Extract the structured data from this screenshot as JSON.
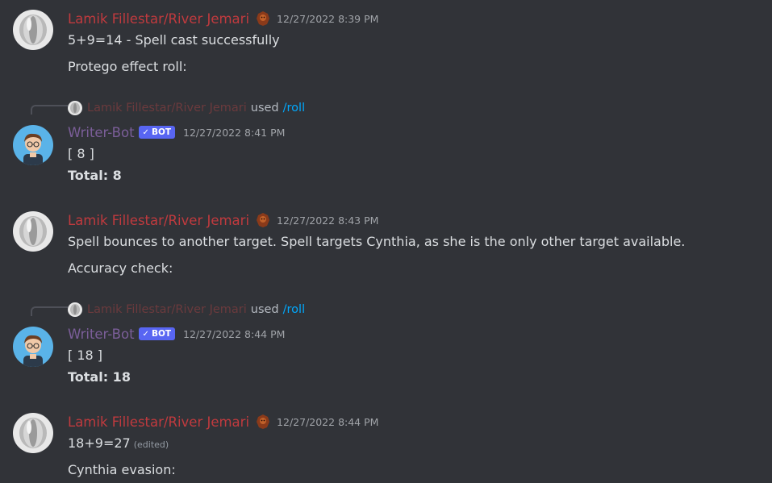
{
  "colors": {
    "background": "#313338",
    "lamik_name": "#c03a3e",
    "bot_name": "#7b5e99",
    "bot_badge": "#5865f2",
    "command": "#00a8fc"
  },
  "messages": [
    {
      "author": "Lamik Fillestar/River Jemari",
      "icon": "house-crest-icon",
      "timestamp": "12/27/2022 8:39 PM",
      "lines": [
        "5+9=14 - Spell cast successfully",
        "Protego effect roll:"
      ]
    },
    {
      "reply": {
        "author": "Lamik Fillestar/River Jemari",
        "used": "used",
        "command": "/roll"
      },
      "author": "Writer-Bot",
      "badge": "BOT",
      "timestamp": "12/27/2022 8:41 PM",
      "roll": "[ 8 ]",
      "total": "Total: 8"
    },
    {
      "author": "Lamik Fillestar/River Jemari",
      "icon": "house-crest-icon",
      "timestamp": "12/27/2022 8:43 PM",
      "lines": [
        "Spell bounces to another target. Spell targets Cynthia, as she is the only other target available.",
        "Accuracy check:"
      ]
    },
    {
      "reply": {
        "author": "Lamik Fillestar/River Jemari",
        "used": "used",
        "command": "/roll"
      },
      "author": "Writer-Bot",
      "badge": "BOT",
      "timestamp": "12/27/2022 8:44 PM",
      "roll": "[ 18 ]",
      "total": "Total: 18"
    },
    {
      "author": "Lamik Fillestar/River Jemari",
      "icon": "house-crest-icon",
      "timestamp": "12/27/2022 8:44 PM",
      "lines": [
        "18+9=27",
        "Cynthia evasion:"
      ],
      "edited": "(edited)"
    }
  ]
}
